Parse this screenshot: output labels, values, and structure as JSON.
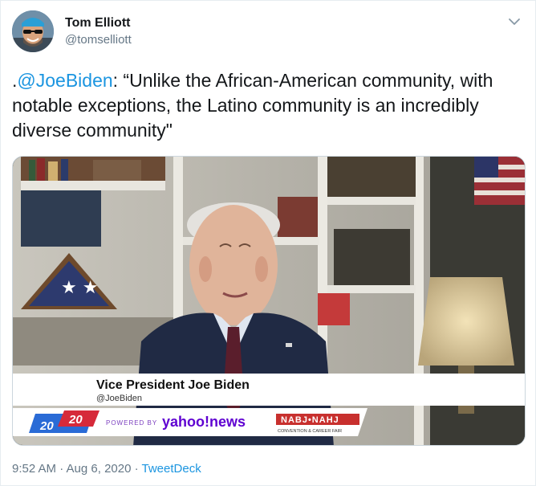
{
  "tweet": {
    "display_name": "Tom Elliott",
    "handle": "@tomselliott",
    "text_mention": "@JoeBiden",
    "text_prefix": ".",
    "text_body": ": “Unlike the African-American community, with notable exceptions, the Latino community is an incredibly diverse community\"",
    "timestamp": "9:52 AM · Aug 6, 2020 · ",
    "source": "TweetDeck"
  },
  "video": {
    "chyron_name": "Vice President Joe Biden",
    "chyron_handle": "@JoeBiden",
    "badge_left": "20",
    "badge_right": "20",
    "powered_by": "POWERED BY",
    "sponsor": "yahoo!news",
    "event_logo": "NABJ•NAHJ",
    "event_sub": "CONVENTION & CAREER FAIR"
  },
  "icons": {
    "menu": "chevron-down-icon"
  }
}
